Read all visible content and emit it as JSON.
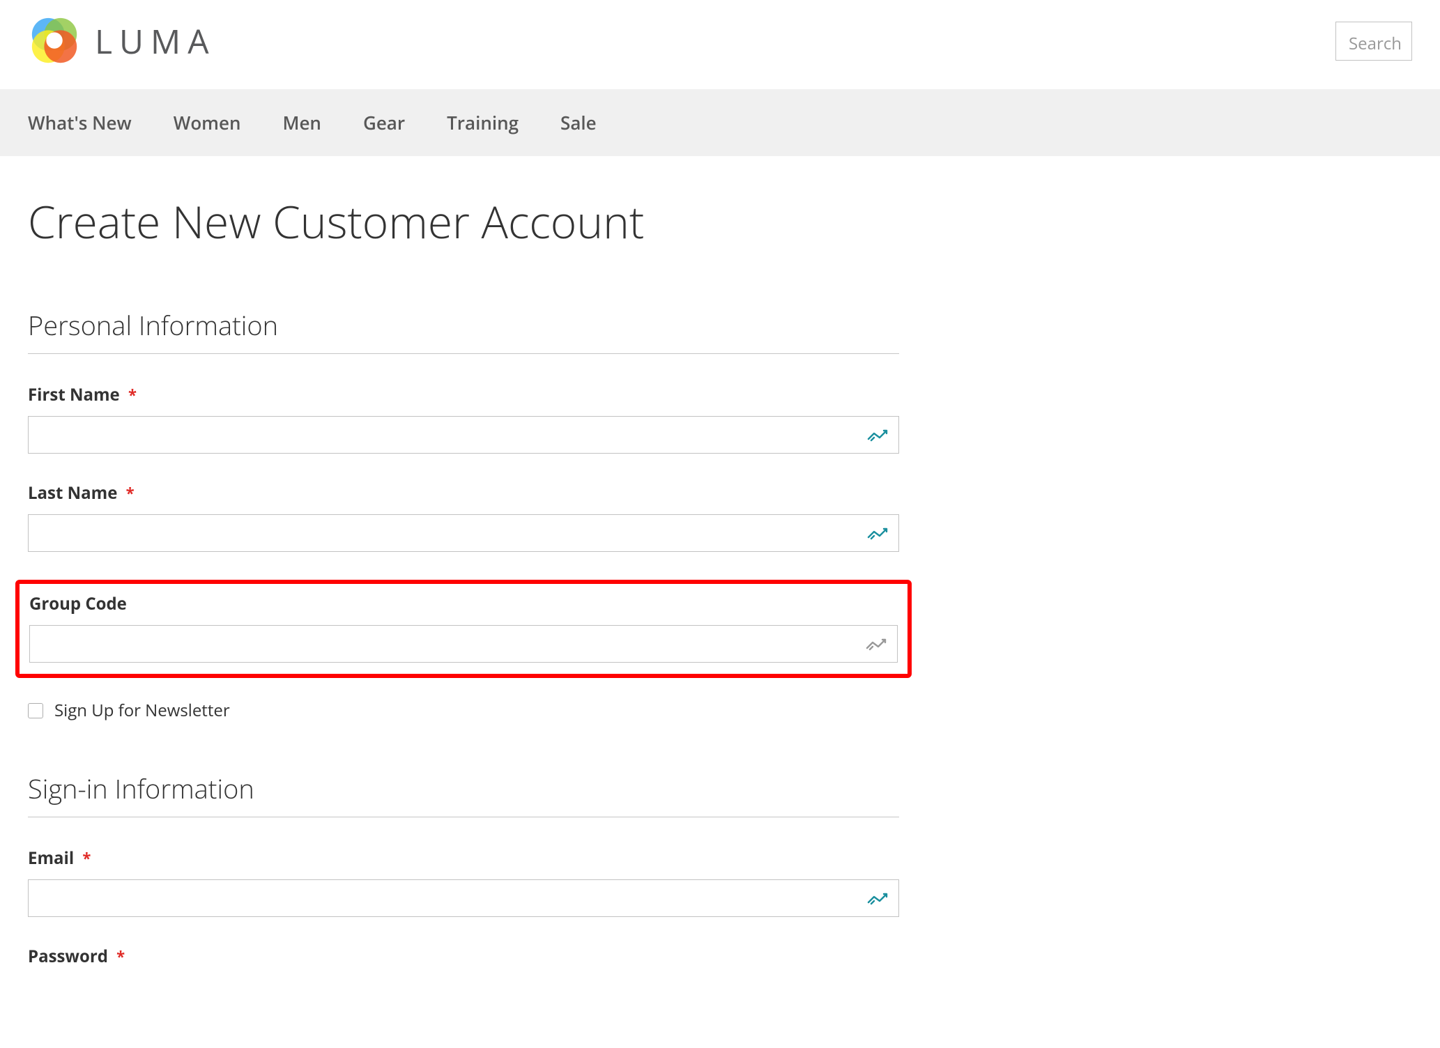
{
  "header": {
    "brand_text": "LUMA",
    "search_placeholder": "Search"
  },
  "nav": {
    "items": [
      {
        "label": "What's New"
      },
      {
        "label": "Women"
      },
      {
        "label": "Men"
      },
      {
        "label": "Gear"
      },
      {
        "label": "Training"
      },
      {
        "label": "Sale"
      }
    ]
  },
  "page": {
    "title": "Create New Customer Account"
  },
  "form": {
    "personal_section_title": "Personal Information",
    "first_name_label": "First Name",
    "last_name_label": "Last Name",
    "group_code_label": "Group Code",
    "newsletter_label": "Sign Up for Newsletter",
    "signin_section_title": "Sign-in Information",
    "email_label": "Email",
    "password_label": "Password",
    "required_mark": "*"
  }
}
